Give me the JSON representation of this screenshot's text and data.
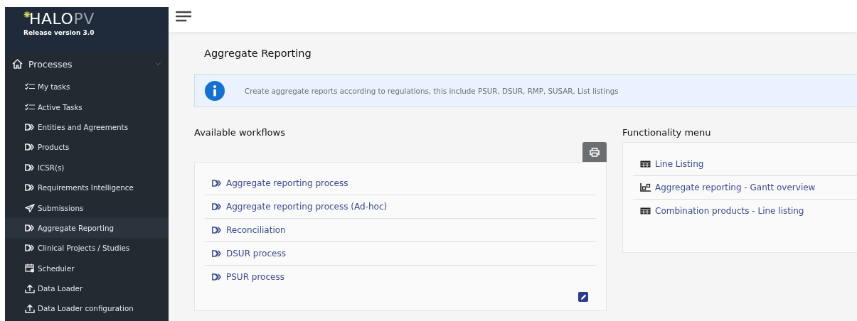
{
  "sidebar": {
    "logo": {
      "brand_main": "HALO",
      "brand_accent": "PV",
      "release": "Release version 3.0"
    },
    "section": {
      "label": "Processes",
      "expanded": true
    },
    "items": [
      {
        "label": "My tasks",
        "kind": "tasks",
        "selected": false
      },
      {
        "label": "Active Tasks",
        "kind": "tasks",
        "selected": false
      },
      {
        "label": "Entities and Agreements",
        "kind": "process",
        "selected": false
      },
      {
        "label": "Products",
        "kind": "process",
        "selected": false
      },
      {
        "label": "ICSR(s)",
        "kind": "process",
        "selected": false
      },
      {
        "label": "Requirements Intelligence",
        "kind": "process",
        "selected": false
      },
      {
        "label": "Submissions",
        "kind": "send",
        "selected": false
      },
      {
        "label": "Aggregate Reporting",
        "kind": "process",
        "selected": true
      },
      {
        "label": "Clinical Projects / Studies",
        "kind": "process",
        "selected": false
      },
      {
        "label": "Scheduler",
        "kind": "scheduler",
        "selected": false
      },
      {
        "label": "Data Loader",
        "kind": "upload",
        "selected": false
      },
      {
        "label": "Data Loader configuration",
        "kind": "upload",
        "selected": false
      }
    ]
  },
  "page": {
    "title": "Aggregate Reporting",
    "info": "Create aggregate reports according to regulations, this include PSUR, DSUR, RMP, SUSAR, List listings"
  },
  "workflows": {
    "heading": "Available workflows",
    "items": [
      {
        "label": "Aggregate reporting process"
      },
      {
        "label": "Aggregate reporting process (Ad-hoc)"
      },
      {
        "label": "Reconciliation"
      },
      {
        "label": "DSUR process"
      },
      {
        "label": "PSUR process"
      }
    ]
  },
  "functionality": {
    "heading": "Functionality menu",
    "items": [
      {
        "label": "Line Listing",
        "kind": "table"
      },
      {
        "label": "Aggregate reporting - Gantt overview",
        "kind": "gantt"
      },
      {
        "label": "Combination products - Line listing",
        "kind": "table"
      }
    ]
  }
}
